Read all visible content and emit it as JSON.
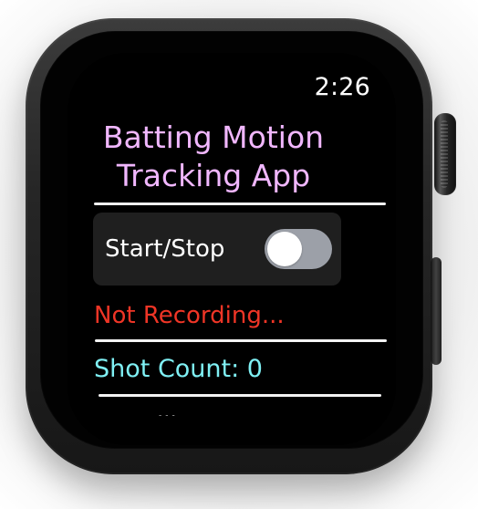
{
  "status_bar": {
    "time": "2:26"
  },
  "app": {
    "title": "Batting Motion\nTracking App"
  },
  "controls": {
    "start_stop_label": "Start/Stop",
    "toggle_state": "off"
  },
  "status": {
    "recording": "Not Recording..."
  },
  "stats": {
    "shot_count_label": "Shot Count: 0"
  },
  "cut_off": {
    "partial_label": "iliu Maat"
  },
  "colors": {
    "title": "#f1b7ff",
    "status_error": "#ef3526",
    "shot_count": "#7ff0f4",
    "toggle_track": "#9ca0a8",
    "card_background": "#1f1f1f"
  },
  "icons": {
    "digital_crown": "crown-icon",
    "side_button": "side-button-icon"
  }
}
